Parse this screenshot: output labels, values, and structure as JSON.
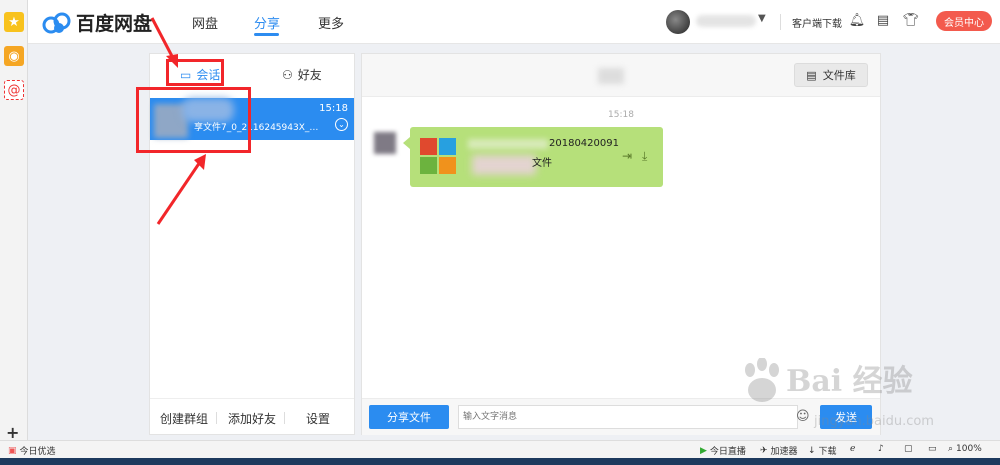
{
  "topnav": {
    "logo_text": "百度网盘",
    "tabs": [
      {
        "label": "网盘",
        "active": false
      },
      {
        "label": "分享",
        "active": true
      },
      {
        "label": "更多",
        "active": false
      }
    ],
    "client_download": "客户端下载",
    "vip_label": "会员中心"
  },
  "left_panel": {
    "tabs": [
      {
        "label": "会话",
        "icon": "chat-icon",
        "active": true
      },
      {
        "label": "好友",
        "icon": "friends-icon",
        "active": false
      }
    ],
    "conversation": {
      "time": "15:18",
      "preview": "享文件7_0_2116245943X_201···"
    },
    "footer": {
      "create_group": "创建群组",
      "add_friend": "添加好友",
      "settings": "设置"
    }
  },
  "right_panel": {
    "file_library": "文件库",
    "message_time": "15:18",
    "file_name_part": "20180420091",
    "file_name_suffix": "文件",
    "share_button": "分享文件",
    "input_placeholder": "输入文字消息",
    "send_button": "发送"
  },
  "watermark": {
    "main": "Bai 经验",
    "sub": "jingyan.baidu.com"
  },
  "status_bar": {
    "today_pick": "今日优选",
    "live": "今日直播",
    "accelerator": "加速器",
    "download": "下载",
    "zoom": "100%"
  },
  "colors": {
    "accent": "#2b8cf0",
    "bubble": "#b6e07a",
    "vip": "#f35a4d",
    "annotation": "#f2262a"
  }
}
